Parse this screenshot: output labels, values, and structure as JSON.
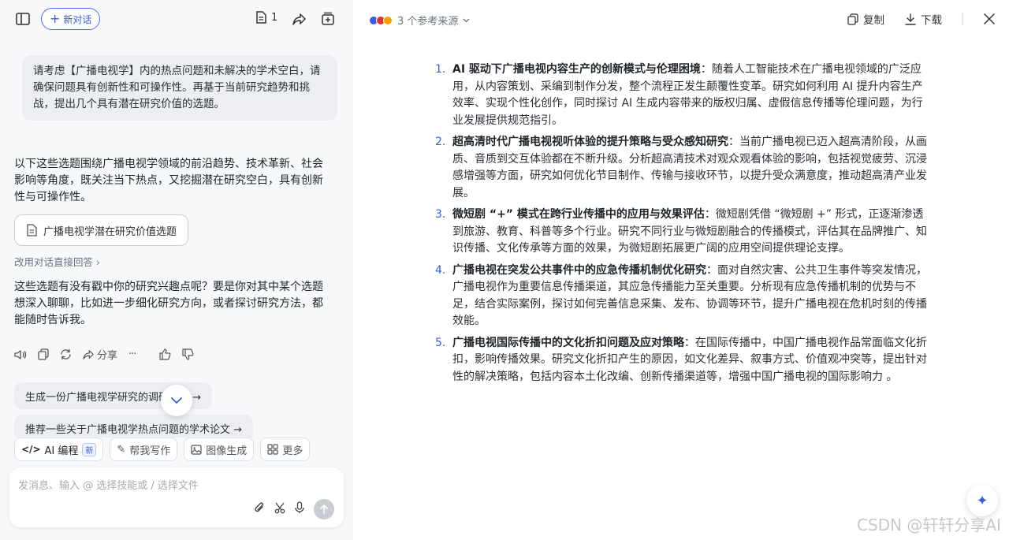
{
  "topbar": {
    "new_chat_label": "新对话",
    "page_count": "1"
  },
  "conversation": {
    "user_prompt": "请考虑【广播电视学】内的热点问题和未解决的学术空白，请确保问题具有创新性和可操作性。再基于当前研究趋势和挑战，提出几个具有潜在研究价值的选题。",
    "ai_intro": "以下这些选题围绕广播电视学领域的前沿趋势、技术革新、社会影响等角度，既关注当下热点，又挖掘潜在研究空白，具有创新性与可操作性。",
    "doc_card_label": "广播电视学潜在研究价值选题",
    "switch_link": "改用对话直接回答",
    "ai_followup": "这些选题有没有戳中你的研究兴趣点呢？要是你对其中某个选题想深入聊聊，比如进一步细化研究方向，或者探讨研究方法，都能随时告诉我。",
    "share_label": "分享",
    "more_dots": "···",
    "suggestions": [
      "生成一份广播电视学研究的调研报告 →",
      "推荐一些关于广播电视学热点问题的学术论文 →"
    ]
  },
  "skills": {
    "ai_code": "AI 编程",
    "new_badge": "新",
    "help_write": "帮我写作",
    "image_gen": "图像生成",
    "more": "更多"
  },
  "input": {
    "placeholder": "发消息、输入 @ 选择技能或 / 选择文件"
  },
  "right": {
    "sources_label": "3 个参考来源",
    "copy_label": "复制",
    "download_label": "下载",
    "items": [
      {
        "num": "1.",
        "title": "AI 驱动下广播电视内容生产的创新模式与伦理困境",
        "body": "：随着人工智能技术在广播电视领域的广泛应用，从内容策划、采编到制作分发，整个流程正发生颠覆性变革。研究如何利用 AI 提升内容生产效率、实现个性化创作，同时探讨 AI 生成内容带来的版权归属、虚假信息传播等伦理问题，为行业发展提供规范指引。"
      },
      {
        "num": "2.",
        "title": "超高清时代广播电视视听体验的提升策略与受众感知研究",
        "body": "：当前广播电视已迈入超高清阶段，从画质、音质到交互体验都在不断升级。分析超高清技术对观众观看体验的影响，包括视觉疲劳、沉浸感增强等方面，研究如何优化节目制作、传输与接收环节，以提升受众满意度，推动超高清产业发展。"
      },
      {
        "num": "3.",
        "title": "微短剧 “+” 模式在跨行业传播中的应用与效果评估",
        "body": "：微短剧凭借 “微短剧 +” 形式，正逐渐渗透到旅游、教育、科普等多个行业。研究不同行业与微短剧融合的传播模式，评估其在品牌推广、知识传播、文化传承等方面的效果，为微短剧拓展更广阔的应用空间提供理论支撑。"
      },
      {
        "num": "4.",
        "title": "广播电视在突发公共事件中的应急传播机制优化研究",
        "body": "：面对自然灾害、公共卫生事件等突发情况，广播电视作为重要信息传播渠道，其应急传播能力至关重要。分析现有应急传播机制的优势与不足，结合实际案例，探讨如何完善信息采集、发布、协调等环节，提升广播电视在危机时刻的传播效能。"
      },
      {
        "num": "5.",
        "title": "广播电视国际传播中的文化折扣问题及应对策略",
        "body": "：在国际传播中，中国广播电视作品常面临文化折扣，影响传播效果。研究文化折扣产生的原因，如文化差异、叙事方式、价值观冲突等，提出针对性的解决策略，包括内容本土化改编、创新传播渠道等，增强中国广播电视的国际影响力 。"
      }
    ],
    "watermark": "CSDN @轩轩分享AI"
  },
  "colors": {
    "accent": "#3b5bdb",
    "panel_bg": "#f7f8fa",
    "bubble_bg": "#eceef2"
  }
}
